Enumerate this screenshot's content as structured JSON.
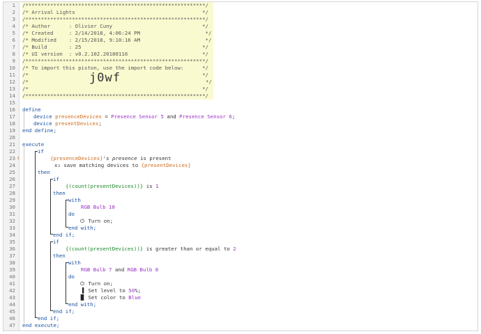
{
  "gutter": {
    "warning_icon_line": 23,
    "lines": [
      "1",
      "2",
      "3",
      "4",
      "5",
      "6",
      "7",
      "8",
      "9",
      "10",
      "11",
      "12",
      "13",
      "14",
      "15",
      "16",
      "17",
      "18",
      "19",
      "20",
      "21",
      "22",
      "23",
      "24",
      "25",
      "26",
      "27",
      "28",
      "29",
      "30",
      "31",
      "32",
      "33",
      "34",
      "35",
      "36",
      "37",
      "38",
      "39",
      "40",
      "41",
      "42",
      "43",
      "44",
      "45",
      "46",
      "47"
    ]
  },
  "header": {
    "border": "/**********************************************************/",
    "title": "/* Arrival Lights                                         */",
    "author": "/* Author      : Olivier Cuny                             */",
    "created": "/* Created     : 2/14/2018, 4:06:24 PM                     */",
    "modified": "/* Modified    : 2/15/2018, 9:10:16 AM                     */",
    "build": "/* Build       : 25                                       */",
    "ui_version": "/* UI version  : v0.2.102.20180116                        */",
    "import_note": "/* To import this piston, use the import code below:      */",
    "blank": "/*                                                        */",
    "code_left": "/*",
    "import_code": "j0wf",
    "code_right": "*/"
  },
  "code": {
    "define": "define",
    "device_kw": "device",
    "presence_var": "presenceDevices",
    "eq": " = ",
    "sensor5": "Presence Sensor 5",
    "and": " and ",
    "sensor6": "Presence Sensor 6",
    "semi": ";",
    "present_var": "presentDevices",
    "end_define": "end define;",
    "execute": "execute",
    "if": "if",
    "cond1_var": "{presenceDevices}",
    "cond1_mid": "'s ",
    "cond1_attr": "presence",
    "cond1_rest": " is present",
    "save_icon": "x₂",
    "save_text": " save matching devices to ",
    "save_var": "{presentDevices}",
    "then": "then",
    "cond2_expr": "{(count(presentDevices))}",
    "cond2_rest": " is ",
    "cond2_val": "1",
    "with": "with",
    "bulb18": "RGB Bulb 18",
    "do": "do",
    "power_icon": "⏻",
    "turn_on": " Turn on;",
    "end_with": "end with;",
    "end_if": "end if;",
    "cond3_expr": "{(count(presentDevices))}",
    "cond3_rest": " is greater than or equal to ",
    "cond3_val": "2",
    "bulb7": "RGB Bulb 7",
    "bulb8": "RGB Bulb 8",
    "level_icon": "▐",
    "set_level": " Set level to ",
    "level_val": "50",
    "level_unit": "%;",
    "color_icon": "█",
    "set_color": " Set color to ",
    "color_val": "Blue",
    "end_execute": "end execute;"
  }
}
